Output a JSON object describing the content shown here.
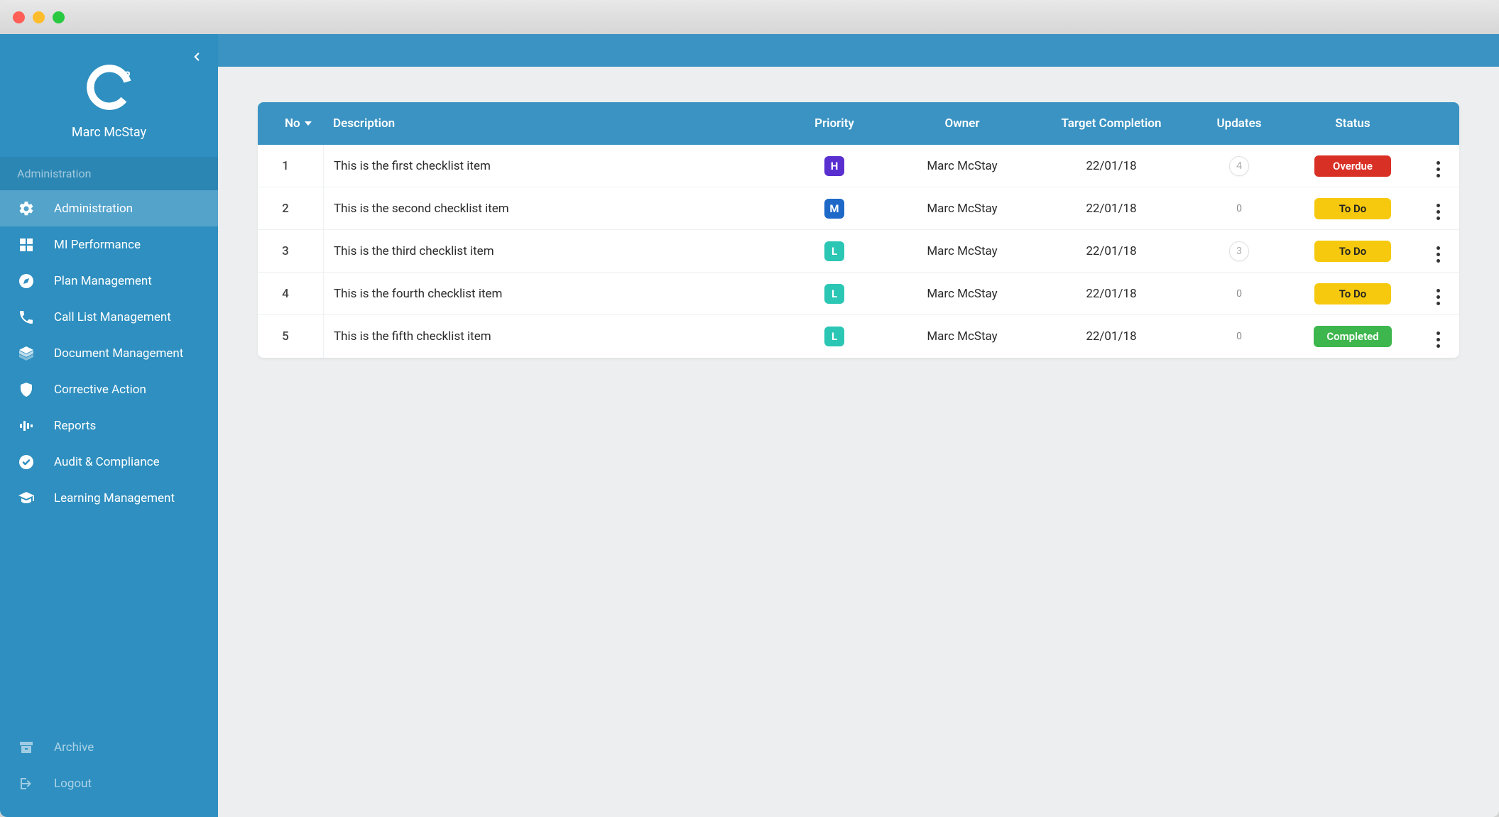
{
  "user": {
    "name": "Marc McStay"
  },
  "sidebar": {
    "section_label": "Administration",
    "items": [
      {
        "id": "administration",
        "label": "Administration",
        "icon": "gear-icon",
        "active": true
      },
      {
        "id": "mi-performance",
        "label": "MI Performance",
        "icon": "dashboard-icon",
        "active": false
      },
      {
        "id": "plan-management",
        "label": "Plan Management",
        "icon": "compass-icon",
        "active": false
      },
      {
        "id": "call-list-management",
        "label": "Call List Management",
        "icon": "phone-icon",
        "active": false
      },
      {
        "id": "document-management",
        "label": "Document Management",
        "icon": "layers-icon",
        "active": false
      },
      {
        "id": "corrective-action",
        "label": "Corrective Action",
        "icon": "shield-icon",
        "active": false
      },
      {
        "id": "reports",
        "label": "Reports",
        "icon": "equalizer-icon",
        "active": false
      },
      {
        "id": "audit-compliance",
        "label": "Audit & Compliance",
        "icon": "check-circle-icon",
        "active": false
      },
      {
        "id": "learning-management",
        "label": "Learning Management",
        "icon": "graduation-icon",
        "active": false
      }
    ],
    "footer": [
      {
        "id": "archive",
        "label": "Archive",
        "icon": "archive-icon"
      },
      {
        "id": "logout",
        "label": "Logout",
        "icon": "logout-icon"
      }
    ]
  },
  "table": {
    "columns": {
      "no": "No",
      "description": "Description",
      "priority": "Priority",
      "owner": "Owner",
      "target_completion": "Target Completion",
      "updates": "Updates",
      "status": "Status"
    },
    "rows": [
      {
        "no": "1",
        "description": "This is the first checklist item",
        "priority": "H",
        "owner": "Marc McStay",
        "target": "22/01/18",
        "updates": "4",
        "updates_has": true,
        "status": "Overdue",
        "status_key": "Overdue"
      },
      {
        "no": "2",
        "description": "This is the second checklist item",
        "priority": "M",
        "owner": "Marc McStay",
        "target": "22/01/18",
        "updates": "0",
        "updates_has": false,
        "status": "To Do",
        "status_key": "ToDo"
      },
      {
        "no": "3",
        "description": "This is the third checklist item",
        "priority": "L",
        "owner": "Marc McStay",
        "target": "22/01/18",
        "updates": "3",
        "updates_has": true,
        "status": "To Do",
        "status_key": "ToDo"
      },
      {
        "no": "4",
        "description": "This is the fourth checklist item",
        "priority": "L",
        "owner": "Marc McStay",
        "target": "22/01/18",
        "updates": "0",
        "updates_has": false,
        "status": "To Do",
        "status_key": "ToDo"
      },
      {
        "no": "5",
        "description": "This is the fifth checklist item",
        "priority": "L",
        "owner": "Marc McStay",
        "target": "22/01/18",
        "updates": "0",
        "updates_has": false,
        "status": "Completed",
        "status_key": "Completed"
      }
    ]
  }
}
